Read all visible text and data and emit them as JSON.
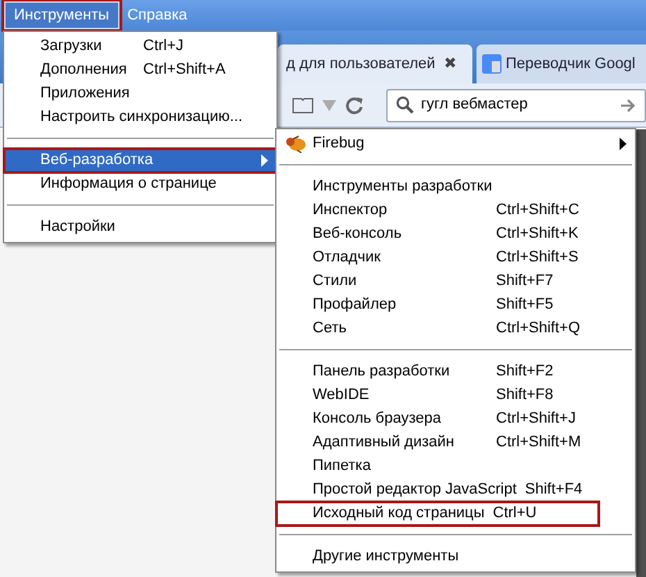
{
  "menu_bar": [
    {
      "label": "Инструменты",
      "selected": true,
      "highlighted": true
    },
    {
      "label": "Справка",
      "selected": false,
      "highlighted": false
    }
  ],
  "tabs": [
    {
      "label": "д для пользователей",
      "close": "✖"
    },
    {
      "label": "Переводчик Googl"
    }
  ],
  "search": {
    "value": "гугл вебмастер"
  },
  "tools_menu": [
    {
      "kind": "item",
      "label": "Загрузки",
      "shortcut": "Ctrl+J",
      "selected": false,
      "highlighted": false
    },
    {
      "kind": "item",
      "label": "Дополнения",
      "shortcut": "Ctrl+Shift+A",
      "selected": false,
      "highlighted": false
    },
    {
      "kind": "item",
      "label": "Приложения",
      "selected": false,
      "highlighted": false
    },
    {
      "kind": "item",
      "label": "Настроить синхронизацию...",
      "selected": false,
      "highlighted": false
    },
    {
      "kind": "separator"
    },
    {
      "kind": "submenu",
      "label": "Веб-разработка",
      "selected": true,
      "highlighted": true
    },
    {
      "kind": "item",
      "label": "Информация о странице",
      "selected": false,
      "highlighted": false
    },
    {
      "kind": "separator"
    },
    {
      "kind": "item",
      "label": "Настройки",
      "selected": false,
      "highlighted": false
    }
  ],
  "web_dev_menu": [
    {
      "kind": "extension",
      "label": "Firebug",
      "selected": false,
      "highlighted": false
    },
    {
      "kind": "separator"
    },
    {
      "kind": "item",
      "label": "Инструменты разработки",
      "selected": false,
      "highlighted": false
    },
    {
      "kind": "item",
      "label": "Инспектор",
      "shortcut": "Ctrl+Shift+C",
      "selected": false,
      "highlighted": false
    },
    {
      "kind": "item",
      "label": "Веб-консоль",
      "shortcut": "Ctrl+Shift+K",
      "selected": false,
      "highlighted": false
    },
    {
      "kind": "item",
      "label": "Отладчик",
      "shortcut": "Ctrl+Shift+S",
      "selected": false,
      "highlighted": false
    },
    {
      "kind": "item",
      "label": "Стили",
      "shortcut": "Shift+F7",
      "selected": false,
      "highlighted": false
    },
    {
      "kind": "item",
      "label": "Профайлер",
      "shortcut": "Shift+F5",
      "selected": false,
      "highlighted": false
    },
    {
      "kind": "item",
      "label": "Сеть",
      "shortcut": "Ctrl+Shift+Q",
      "selected": false,
      "highlighted": false
    },
    {
      "kind": "separator"
    },
    {
      "kind": "item",
      "label": "Панель разработки",
      "shortcut": "Shift+F2",
      "selected": false,
      "highlighted": false
    },
    {
      "kind": "item",
      "label": "WebIDE",
      "shortcut": "Shift+F8",
      "selected": false,
      "highlighted": false
    },
    {
      "kind": "item",
      "label": "Консоль браузера",
      "shortcut": "Ctrl+Shift+J",
      "selected": false,
      "highlighted": false
    },
    {
      "kind": "item",
      "label": "Адаптивный дизайн",
      "shortcut": "Ctrl+Shift+M",
      "selected": false,
      "highlighted": false
    },
    {
      "kind": "item",
      "label": "Пипетка",
      "selected": false,
      "highlighted": false
    },
    {
      "kind": "item",
      "label": "Простой редактор JavaScript",
      "shortcut": "Shift+F4",
      "selected": false,
      "highlighted": false
    },
    {
      "kind": "item",
      "label": "Исходный код страницы",
      "shortcut": "Ctrl+U",
      "selected": false,
      "highlighted": true
    },
    {
      "kind": "separator"
    },
    {
      "kind": "item",
      "label": "Другие инструменты",
      "selected": false,
      "highlighted": false
    }
  ]
}
